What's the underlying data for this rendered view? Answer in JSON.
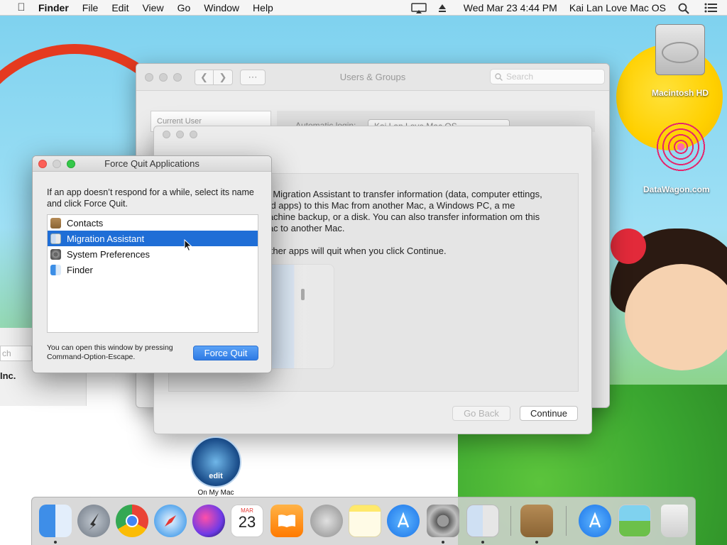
{
  "menubar": {
    "app_name": "Finder",
    "items": [
      "File",
      "Edit",
      "View",
      "Go",
      "Window",
      "Help"
    ],
    "datetime": "Wed Mar 23  4:44 PM",
    "user": "Kai Lan Love Mac OS"
  },
  "desktop": {
    "hd_label": "Macintosh HD",
    "datawagon_label": "DataWagon.com",
    "on_my_mac_label": "On My Mac",
    "on_my_mac_badge": "edit",
    "frag_search": "ch",
    "frag_inc": "Inc."
  },
  "users_groups": {
    "title": "Users & Groups",
    "search_placeholder": "Search",
    "sidebar_header": "Current User",
    "autologin_label": "Automatic login:",
    "autologin_value": "Kai Lan Love Mac OS"
  },
  "migration": {
    "paragraph1": "se Migration Assistant to transfer information (data, computer ettings, and apps) to this Mac from another Mac, a Windows PC, a me Machine backup, or a disk. You can also transfer information om this Mac to another Mac.",
    "paragraph2": "l other apps will quit when you click Continue.",
    "back_label": "Go Back",
    "continue_label": "Continue"
  },
  "force_quit": {
    "title": "Force Quit Applications",
    "description": "If an app doesn’t respond for a while, select its name and click Force Quit.",
    "apps": [
      {
        "name": "Contacts",
        "icon": "contacts-icon"
      },
      {
        "name": "Migration Assistant",
        "icon": "migration-assistant-icon",
        "selected": true
      },
      {
        "name": "System Preferences",
        "icon": "system-preferences-icon"
      },
      {
        "name": "Finder",
        "icon": "finder-icon"
      }
    ],
    "footer": "You can open this window by pressing Command-Option-Escape.",
    "button_label": "Force Quit"
  },
  "dock": {
    "apps": [
      "finder",
      "launchpad",
      "chrome",
      "safari",
      "siri",
      "calendar",
      "books",
      "automator",
      "notes",
      "app-store",
      "system-preferences",
      "migration-assistant",
      "contacts",
      "downloads",
      "photos",
      "trash"
    ],
    "calendar_month": "MAR",
    "calendar_day": "23"
  },
  "colors": {
    "selection": "#1f6ed6",
    "accent_button": "#2e7ae4"
  }
}
